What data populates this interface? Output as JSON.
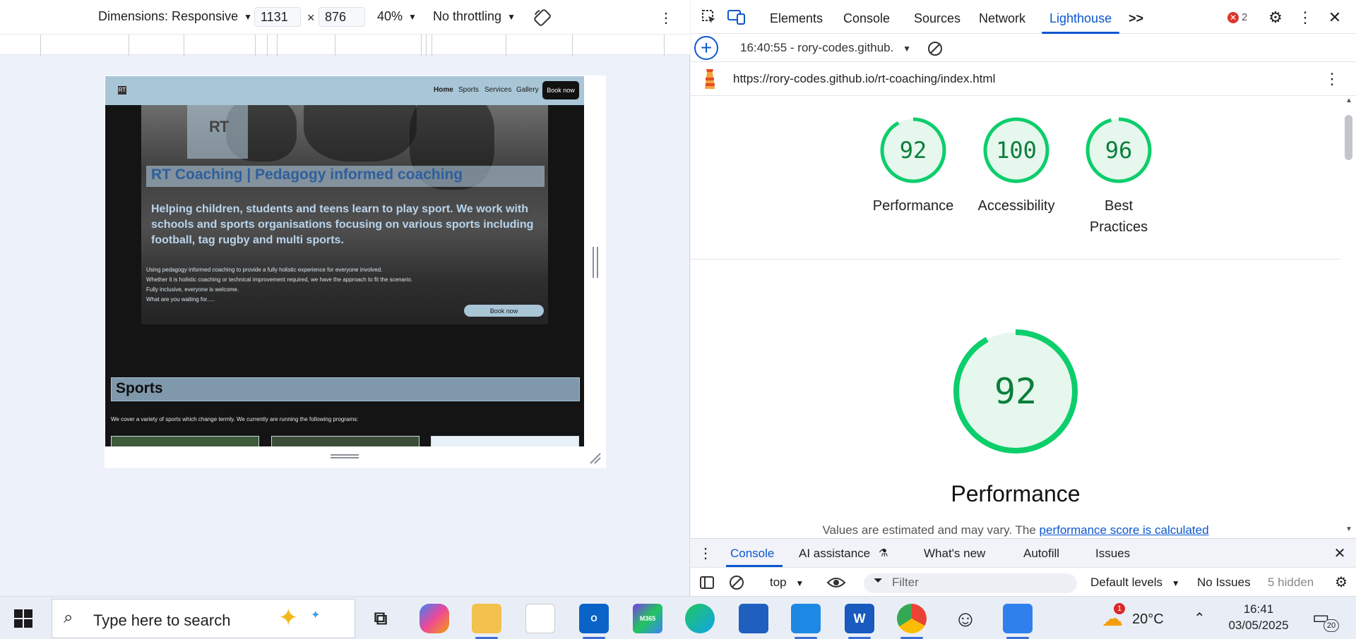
{
  "device_toolbar": {
    "dimensions_label": "Dimensions: Responsive",
    "width": "1131",
    "height": "876",
    "times": "×",
    "zoom": "40%",
    "throttling": "No throttling"
  },
  "emulated_site": {
    "nav": {
      "logo": "RT",
      "links": [
        "Home",
        "Sports",
        "Services",
        "Gallery"
      ],
      "book_button": "Book now"
    },
    "hero": {
      "logo_text": "RT",
      "title": "RT Coaching | Pedagogy informed coaching",
      "lead": "Helping children, students and teens learn to play sport. We work with schools and sports organisations focusing on various sports including football, tag rugby and multi sports.",
      "lines": [
        "Using pedagogy informed coaching to provide a fully holistic experience for everyone involved.",
        "Whether it is holistic coaching or technical improvement required, we have the approach to fit the scenario.",
        "Fully inclusive, everyone is welcome.",
        "What are you waiting for....."
      ],
      "book_button": "Book now"
    },
    "sports": {
      "title": "Sports",
      "description": "We cover a variety of sports which change termly. We currently are running the following programs:"
    }
  },
  "devtools": {
    "tabs": [
      "Elements",
      "Console",
      "Sources",
      "Network",
      "Lighthouse"
    ],
    "active_tab": "Lighthouse",
    "more_tabs": ">>",
    "error_count": "2",
    "report_select": "16:40:55 - rory-codes.github.",
    "url": "https://rory-codes.github.io/rt-coaching/index.html",
    "scores": [
      {
        "label": "Performance",
        "value": 92
      },
      {
        "label": "Accessibility",
        "value": 100
      },
      {
        "label": "Best Practices",
        "value": 96
      }
    ],
    "section": {
      "title": "Performance",
      "score": 92,
      "note_prefix": "Values are estimated and may vary. The ",
      "note_link": "performance score is calculated"
    }
  },
  "drawer": {
    "tabs": [
      "Console",
      "AI assistance",
      "What's new",
      "Autofill",
      "Issues"
    ],
    "active_tab": "Console",
    "context": "top",
    "filter_placeholder": "Filter",
    "levels": "Default levels",
    "issues": "No Issues",
    "hidden": "5 hidden"
  },
  "taskbar": {
    "search_placeholder": "Type here to search",
    "weather_badge": "1",
    "temperature": "20°C",
    "time": "16:41",
    "date": "03/05/2025",
    "notifications": "20",
    "apps": [
      "task-view",
      "copilot",
      "file-explorer",
      "notepad",
      "outlook",
      "microsoft-365",
      "edge",
      "microsoft-store",
      "vscode",
      "word",
      "chrome",
      "emoji",
      "photos"
    ],
    "m365_label": "M365",
    "word_label": "W"
  },
  "colors": {
    "accent": "#0b57d0",
    "score_good": "#0cce6b",
    "score_text": "#0b7e3b"
  }
}
